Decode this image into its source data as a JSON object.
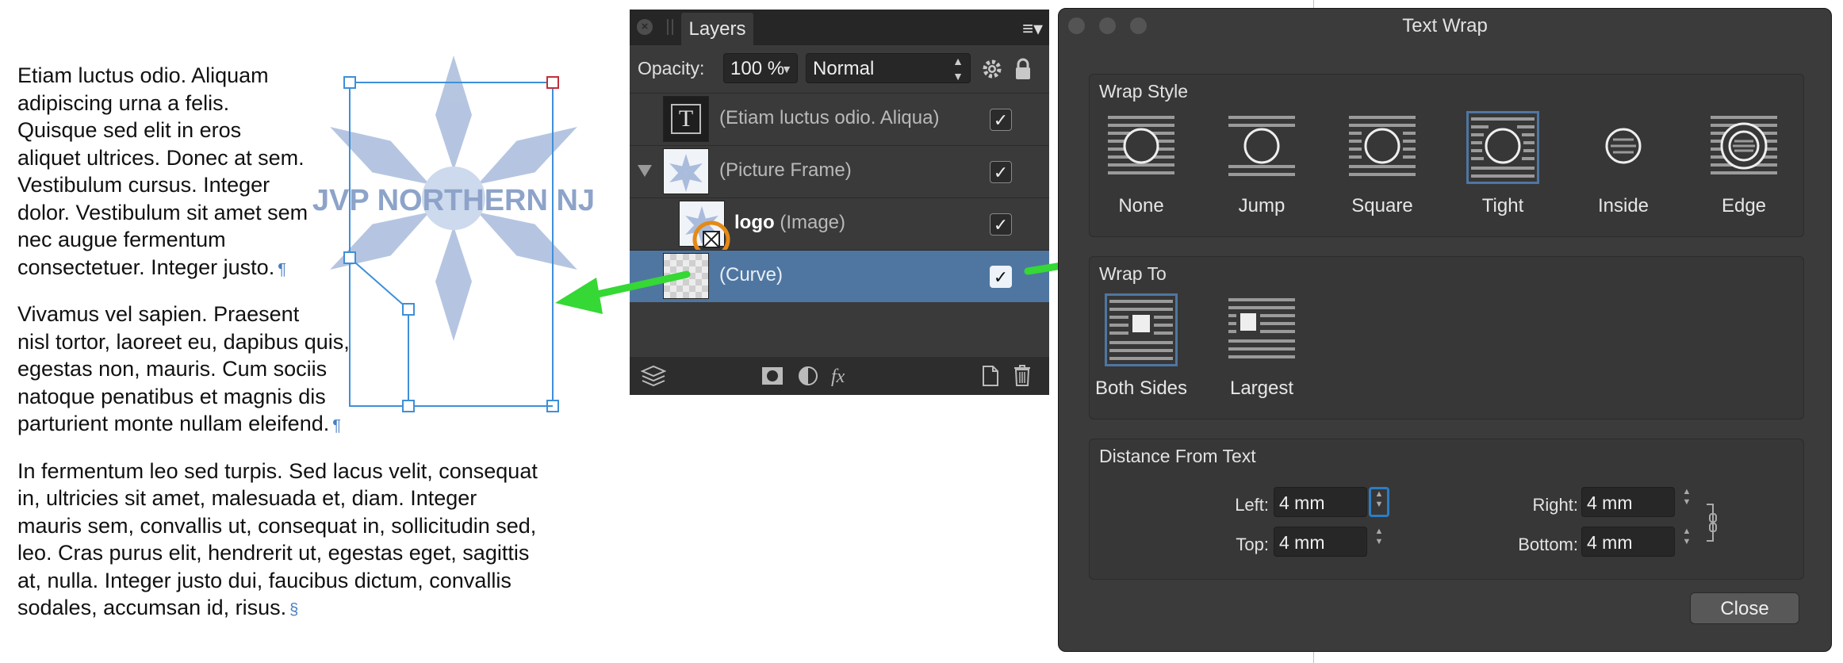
{
  "document": {
    "paragraphs": [
      {
        "lines": [
          "Etiam luctus odio. Aliquam",
          "adipiscing urna a felis.",
          "Quisque sed elit in eros",
          "aliquet ultrices. Donec at sem.",
          "Vestibulum cursus. Integer",
          "dolor. Vestibulum sit amet sem",
          "nec augue fermentum",
          "consectetuer. Integer justo."
        ],
        "end_mark": "¶"
      },
      {
        "lines": [
          "Vivamus vel sapien. Praesent",
          "nisl tortor, laoreet eu, dapibus quis,",
          "egestas non, mauris. Cum sociis",
          "natoque penatibus et magnis dis",
          "parturient monte nullam eleifend."
        ],
        "end_mark": "¶"
      },
      {
        "lines": [
          "In fermentum leo sed turpis. Sed lacus velit, consequat",
          "in, ultricies sit amet, malesuada et, diam. Integer",
          "mauris sem, convallis ut, consequat in, sollicitudin sed,",
          "leo. Cras purus elit, hendrerit ut, egestas eget, sagittis",
          "at, nulla. Integer justo dui, faucibus dictum, convallis",
          "sodales, accumsan id, risus."
        ],
        "end_mark": "§"
      }
    ],
    "logo_text": "JVP NORTHERN NJ"
  },
  "layers_panel": {
    "tab_label": "Layers",
    "opacity_label": "Opacity:",
    "opacity_value": "100 %",
    "blend_mode": "Normal",
    "rows": [
      {
        "name": "(Etiam luctus odio. Aliqua)",
        "checked": "✓"
      },
      {
        "name": "(Picture Frame)",
        "checked": "✓"
      },
      {
        "name_bold": "logo",
        "name": " (Image)",
        "checked": "✓"
      },
      {
        "name": "(Curve)",
        "checked": "✓",
        "selected": true
      }
    ],
    "footer_fx": "fx"
  },
  "text_wrap_dialog": {
    "title": "Text Wrap",
    "wrap_style": {
      "title": "Wrap Style",
      "options": [
        "None",
        "Jump",
        "Square",
        "Tight",
        "Inside",
        "Edge"
      ],
      "selected": "Tight"
    },
    "wrap_to": {
      "title": "Wrap To",
      "options": [
        "Both Sides",
        "Largest"
      ],
      "selected": "Both Sides"
    },
    "distance": {
      "title": "Distance From Text",
      "left_label": "Left:",
      "left_value": "4 mm",
      "top_label": "Top:",
      "top_value": "4 mm",
      "right_label": "Right:",
      "right_value": "4 mm",
      "bottom_label": "Bottom:",
      "bottom_value": "4 mm"
    },
    "close_label": "Close"
  },
  "colors": {
    "selection_blue": "#4f76a1",
    "logo_blue": "#a9bcdc",
    "arrow_green": "#35d835",
    "highlight_orange": "#e48a17"
  }
}
